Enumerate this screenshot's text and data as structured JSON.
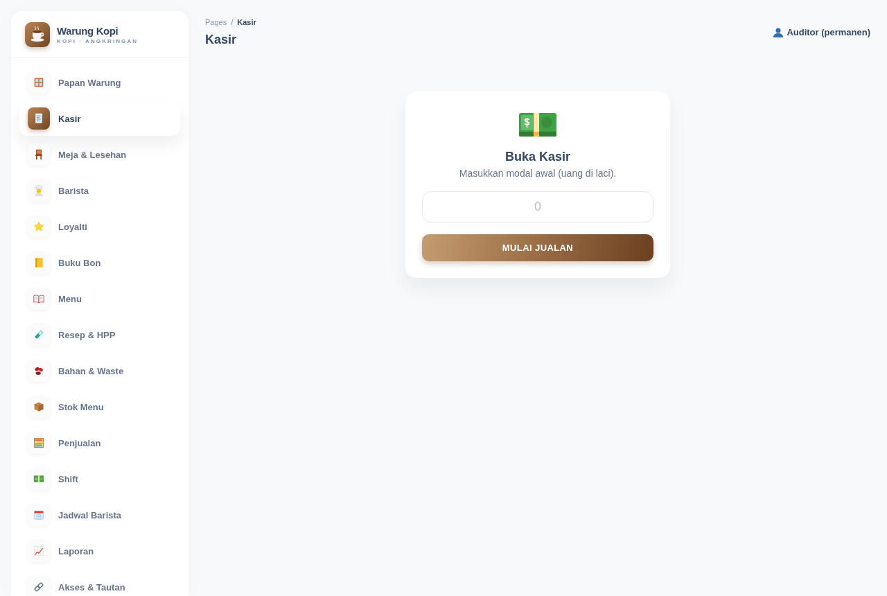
{
  "brand": {
    "name": "Warung Kopi",
    "tagline": "KOPI · ANGKRINGAN"
  },
  "sidebar": {
    "items": [
      {
        "label": "Papan Warung",
        "selected": false
      },
      {
        "label": "Kasir",
        "selected": true
      },
      {
        "label": "Meja & Lesehan",
        "selected": false
      },
      {
        "label": "Barista",
        "selected": false
      },
      {
        "label": "Loyalti",
        "selected": false
      },
      {
        "label": "Buku Bon",
        "selected": false
      },
      {
        "label": "Menu",
        "selected": false
      },
      {
        "label": "Resep & HPP",
        "selected": false
      },
      {
        "label": "Bahan & Waste",
        "selected": false
      },
      {
        "label": "Stok Menu",
        "selected": false
      },
      {
        "label": "Penjualan",
        "selected": false
      },
      {
        "label": "Shift",
        "selected": false
      },
      {
        "label": "Jadwal Barista",
        "selected": false
      },
      {
        "label": "Laporan",
        "selected": false
      },
      {
        "label": "Akses & Tautan",
        "selected": false
      }
    ]
  },
  "breadcrumb": {
    "parent": "Pages",
    "separator": "/",
    "current": "Kasir"
  },
  "page_title": "Kasir",
  "user": {
    "label": "Auditor (permanen)"
  },
  "open_register_card": {
    "title": "Buka Kasir",
    "subtitle": "Masukkan modal awal (uang di laci).",
    "amount_field": {
      "placeholder": "0"
    },
    "button": "MULAI JUALAN"
  }
}
